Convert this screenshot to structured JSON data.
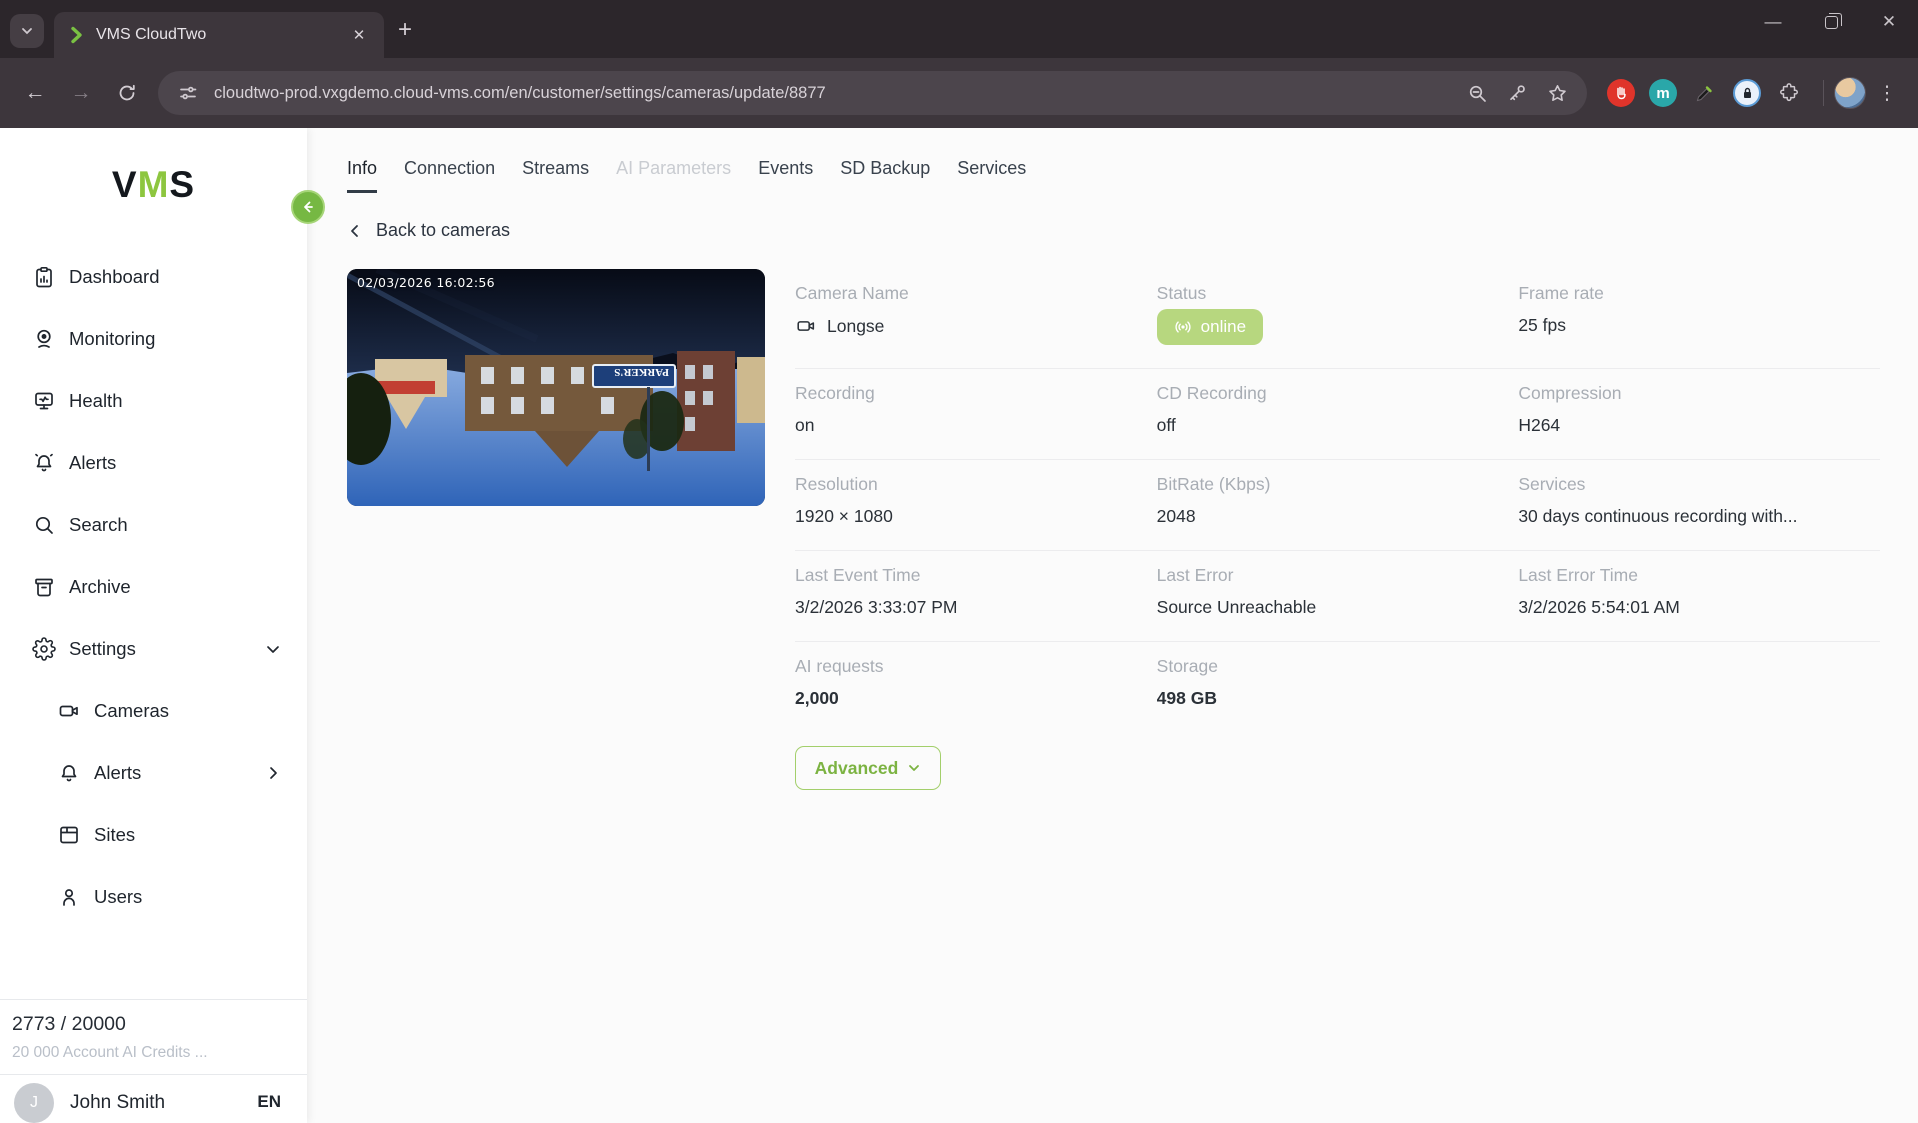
{
  "colors": {
    "accent": "#8dc63f",
    "accent-dark": "#7cb342",
    "badge-bg": "#b7d77f",
    "chrome-strip": "#2c262b",
    "chrome-toolbar": "#3d363c",
    "chrome-pill": "#4c454c"
  },
  "browser": {
    "tab_title": "VMS CloudTwo",
    "url": "cloudtwo-prod.vxgdemo.cloud-vms.com/en/customer/settings/cameras/update/8877",
    "extension_m_label": "m",
    "icons": [
      "tab-search-chevron",
      "favicon-green-chevron",
      "close",
      "new-tab-plus",
      "minimize",
      "restore",
      "close-window",
      "back-arrow",
      "forward-arrow",
      "reload",
      "site-settings",
      "zoom-out",
      "password-key",
      "bookmark-star",
      "adblock-hand",
      "monica-m",
      "eyedropper",
      "password-lock",
      "extensions-puzzle",
      "profile-avatar",
      "kebab-menu"
    ]
  },
  "sidebar": {
    "logo": {
      "part1": "V",
      "part2": "M",
      "part3": "S"
    },
    "items": [
      {
        "label": "Dashboard",
        "icon": "dashboard-icon"
      },
      {
        "label": "Monitoring",
        "icon": "webcam-icon"
      },
      {
        "label": "Health",
        "icon": "health-monitor-icon"
      },
      {
        "label": "Alerts",
        "icon": "bell-ring-icon"
      },
      {
        "label": "Search",
        "icon": "search-icon"
      },
      {
        "label": "Archive",
        "icon": "archive-icon"
      },
      {
        "label": "Settings",
        "icon": "gear-icon",
        "expanded": true
      }
    ],
    "sub_items": [
      {
        "label": "Cameras",
        "icon": "video-camera-icon"
      },
      {
        "label": "Alerts",
        "icon": "bell-icon",
        "has_children": true
      },
      {
        "label": "Sites",
        "icon": "window-icon"
      },
      {
        "label": "Users",
        "icon": "person-icon"
      }
    ],
    "credits": {
      "used": "2773 / 20000",
      "caption": "20 000 Account AI Credits ..."
    },
    "user": {
      "initial": "J",
      "name": "John Smith",
      "language": "EN"
    }
  },
  "main": {
    "tabs": [
      {
        "label": "Info",
        "state": "active"
      },
      {
        "label": "Connection",
        "state": "normal"
      },
      {
        "label": "Streams",
        "state": "normal"
      },
      {
        "label": "AI Parameters",
        "state": "disabled"
      },
      {
        "label": "Events",
        "state": "normal"
      },
      {
        "label": "SD Backup",
        "state": "normal"
      },
      {
        "label": "Services",
        "state": "normal"
      }
    ],
    "back_link": "Back to cameras",
    "camera_preview": {
      "timestamp": "02/03/2026 16:02:56",
      "sign_text": "PARKER'S"
    },
    "details": {
      "fields": [
        {
          "label": "Camera Name",
          "value": "Longse"
        },
        {
          "label": "Status",
          "value": "online"
        },
        {
          "label": "Frame rate",
          "value": "25 fps"
        },
        {
          "label": "Recording",
          "value": "on"
        },
        {
          "label": "CD Recording",
          "value": "off"
        },
        {
          "label": "Compression",
          "value": "H264"
        },
        {
          "label": "Resolution",
          "value": "1920 × 1080"
        },
        {
          "label": "BitRate (Kbps)",
          "value": "2048"
        },
        {
          "label": "Services",
          "value": "30 days continuous recording with..."
        },
        {
          "label": "Last Event Time",
          "value": "3/2/2026 3:33:07 PM"
        },
        {
          "label": "Last Error",
          "value": "Source Unreachable"
        },
        {
          "label": "Last Error Time",
          "value": "3/2/2026 5:54:01 AM"
        },
        {
          "label": "AI requests",
          "value": "2,000"
        },
        {
          "label": "Storage",
          "value": "498 GB"
        }
      ]
    },
    "advanced_button": "Advanced"
  }
}
